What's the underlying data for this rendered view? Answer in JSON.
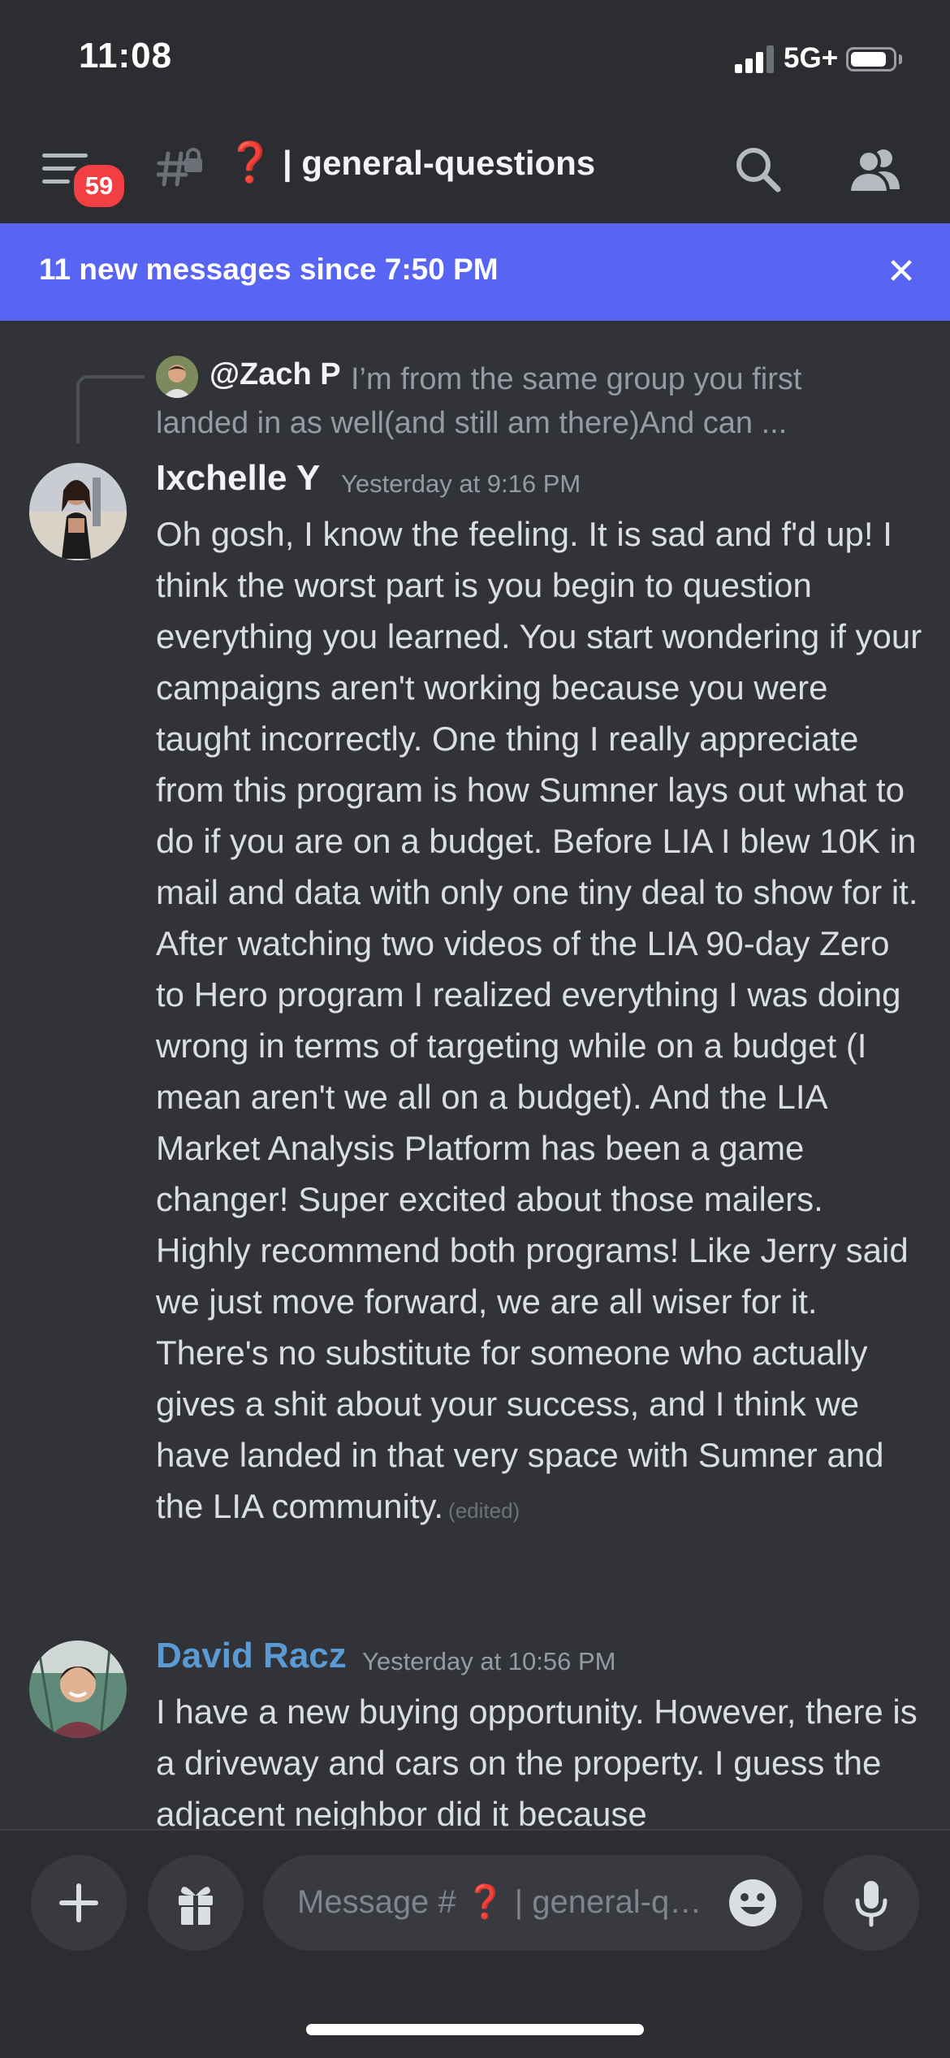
{
  "status_bar": {
    "time": "11:08",
    "network": "5G+",
    "battery_level": 0.85
  },
  "header": {
    "unread_count": "59",
    "channel_emoji": "❓",
    "channel_name": "| general-questions",
    "icons": [
      "menu-icon",
      "locked-channel-icon",
      "search-icon",
      "members-icon"
    ]
  },
  "new_messages_bar": {
    "text": "11 new messages since 7:50 PM",
    "close_icon": "close-icon"
  },
  "reply": {
    "mention": "@Zach P",
    "preview": "I’m from the same group you first landed in as well(and still am there)And can ..."
  },
  "messages": [
    {
      "author": "Ixchelle Y",
      "author_color": "#f2f3f5",
      "timestamp": "Yesterday at 9:16 PM",
      "text": "Oh gosh, I know the feeling. It is sad and f'd up! I think the worst part is you begin to question everything you learned. You start wondering if your campaigns aren't working because you were taught incorrectly. One thing I really appreciate from this program is how Sumner lays out what to do if you are on a budget. Before LIA I blew 10K in mail and data with only one tiny deal to show for it. After watching two videos of the LIA 90-day Zero to Hero program I realized everything I was doing wrong in terms of targeting while on a budget (I mean aren't we all on a budget). And the LIA Market Analysis Platform has been a game changer! Super excited about those mailers. Highly recommend both programs! Like Jerry said we just move forward, we are all wiser for it. There's no substitute for someone who actually gives a shit about your success, and I think we have landed in that very space with Sumner and the LIA community.",
      "edited": "(edited)"
    },
    {
      "author": "David Racz",
      "author_color": "#5b9bd5",
      "timestamp": "Yesterday at 10:56 PM",
      "text": "I have a new buying opportunity. However, there is a driveway and cars on the property. I guess the adjacent neighbor did it because"
    }
  ],
  "composer": {
    "placeholder": "Message # ❓ | general-questions",
    "icons": [
      "plus-icon",
      "gift-icon",
      "emoji-icon",
      "microphone-icon"
    ]
  }
}
